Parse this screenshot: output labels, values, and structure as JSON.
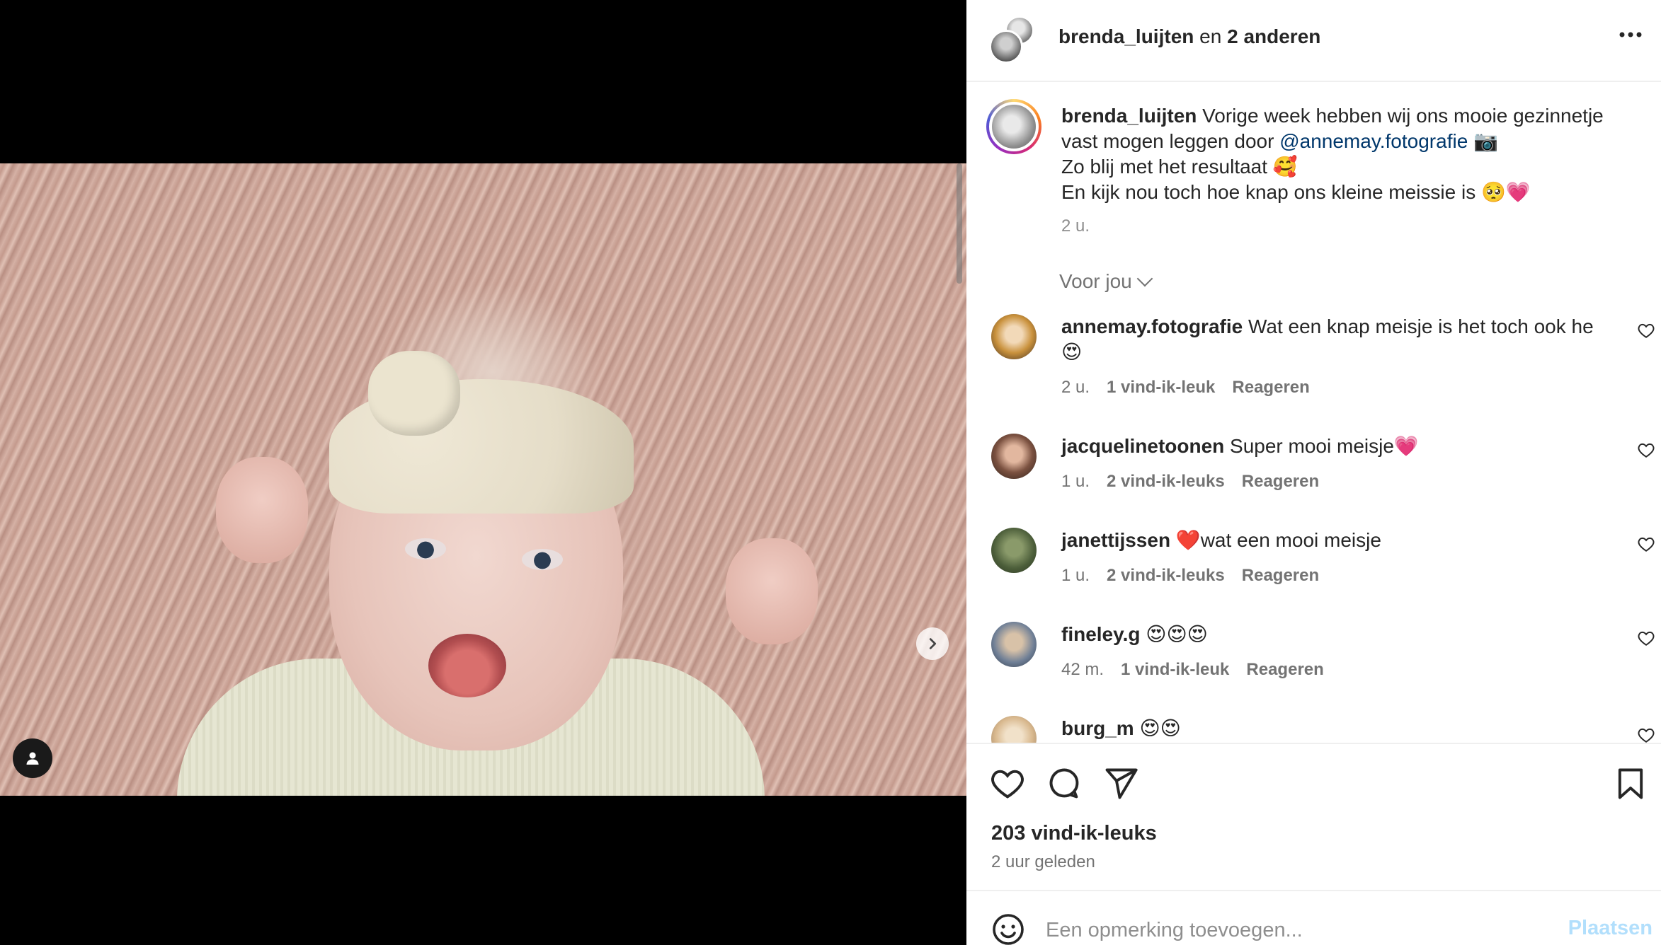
{
  "header": {
    "username": "brenda_luijten",
    "connector": "en",
    "others": "2 anderen",
    "more": "···"
  },
  "caption": {
    "username": "brenda_luijten",
    "line1": "Vorige week hebben wij ons mooie gezinnetje vast mogen leggen door",
    "mention": "@annemay.fotografie",
    "line1_emoji": "📷",
    "line2": "Zo blij met het resultaat 🥰",
    "line3": "En kijk nou toch hoe knap ons kleine meissie is 🥺💗",
    "time": "2 u."
  },
  "filter": {
    "label": "Voor jou"
  },
  "comments": [
    {
      "user": "annemay.fotografie",
      "text": "Wat een knap meisje is het toch ook he 😍",
      "time": "2 u.",
      "likes": "1 vind-ik-leuk",
      "reply": "Reageren"
    },
    {
      "user": "jacquelinetoonen",
      "text": "Super mooi meisje💗",
      "time": "1 u.",
      "likes": "2 vind-ik-leuks",
      "reply": "Reageren"
    },
    {
      "user": "janettijssen",
      "text": "❤️wat een mooi meisje",
      "time": "1 u.",
      "likes": "2 vind-ik-leuks",
      "reply": "Reageren"
    },
    {
      "user": "fineley.g",
      "text": "😍😍😍",
      "time": "42 m.",
      "likes": "1 vind-ik-leuk",
      "reply": "Reageren"
    },
    {
      "user": "burg_m",
      "text": "😍😍",
      "time": "",
      "likes": "",
      "reply": ""
    }
  ],
  "actions": {
    "likes": "203 vind-ik-leuks",
    "ago": "2 uur geleden"
  },
  "compose": {
    "placeholder": "Een opmerking toevoegen...",
    "post": "Plaatsen"
  },
  "carousel": {
    "count": 6,
    "active_index": 0
  },
  "colors": {
    "mention": "#00376b",
    "post_disabled": "#b2dffc",
    "meta": "#737373"
  }
}
